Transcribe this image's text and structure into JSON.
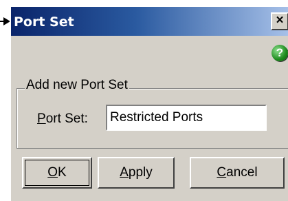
{
  "window": {
    "title": "Port Set",
    "close_glyph": "×"
  },
  "help_icon": {
    "glyph": "?",
    "name": "help-icon"
  },
  "group": {
    "legend": "Add new Port Set"
  },
  "field": {
    "label_mnemonic": "P",
    "label_rest": "ort Set:",
    "value": "Restricted Ports"
  },
  "buttons": {
    "ok": {
      "mnemonic": "O",
      "rest": "K"
    },
    "apply": {
      "mnemonic": "A",
      "rest": "pply"
    },
    "cancel": {
      "mnemonic": "C",
      "rest": "ancel"
    }
  },
  "colors": {
    "dialog_bg": "#d4d0c8",
    "title_start": "#0a246a",
    "title_end": "#a6c0e8",
    "help_green": "#1d8a1d"
  }
}
